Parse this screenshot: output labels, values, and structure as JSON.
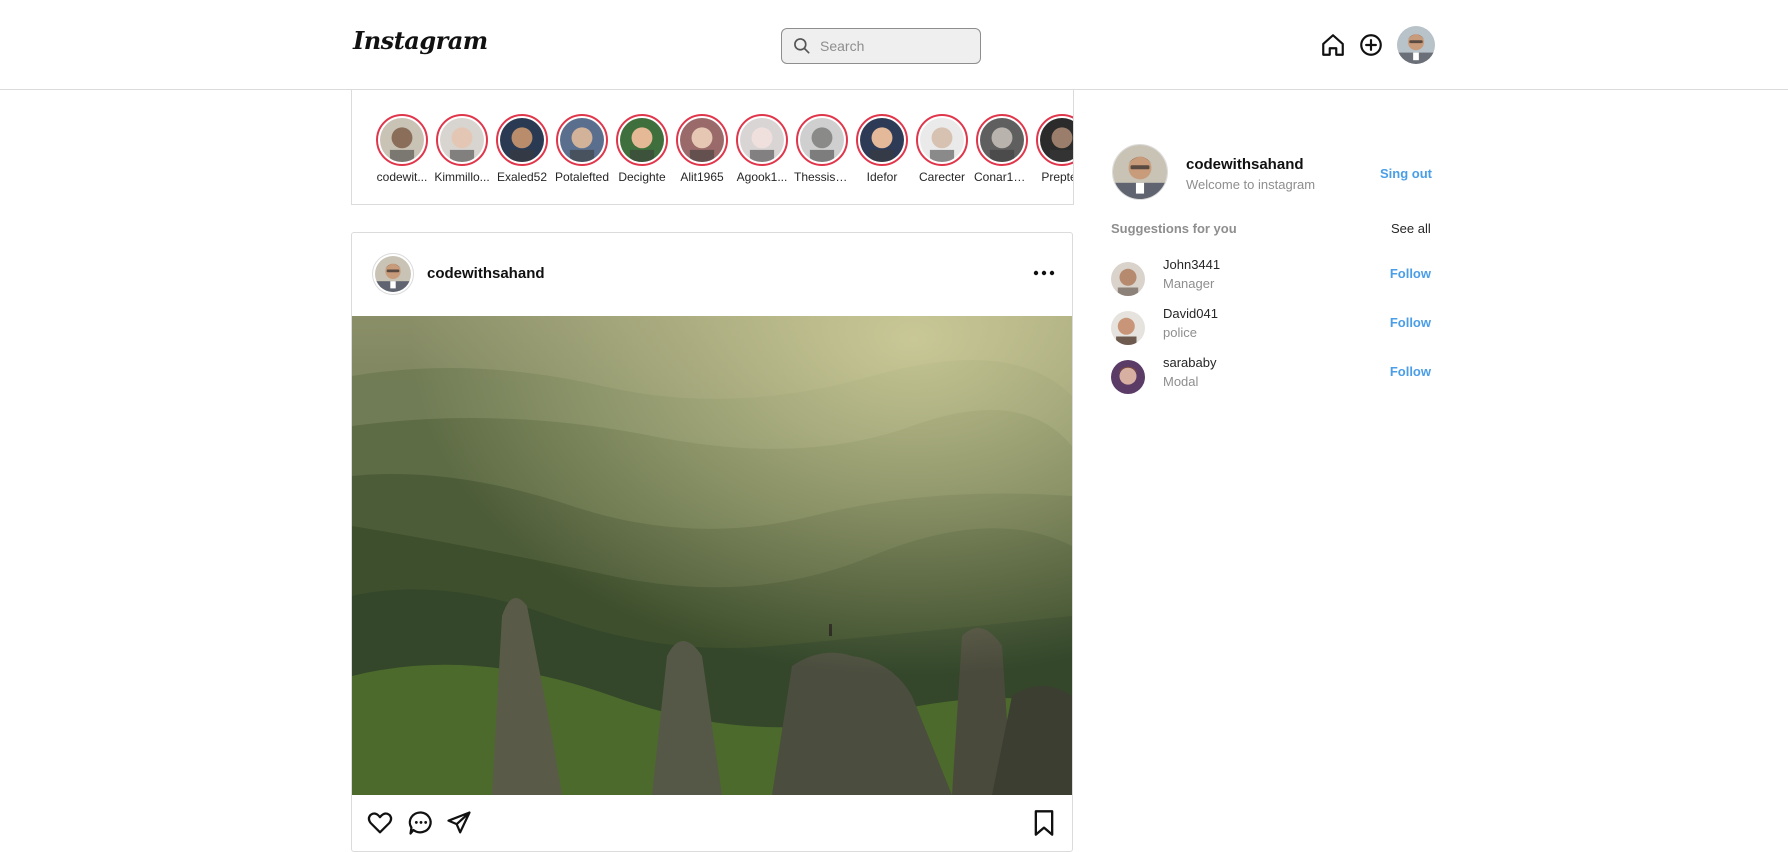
{
  "header": {
    "logo": "Instagram",
    "search_placeholder": "Search",
    "icons": [
      "home-icon",
      "add-post-icon",
      "profile-avatar"
    ]
  },
  "stories": [
    {
      "name": "codewit...",
      "tone": "#8a6e5a",
      "bg": "#c9c3b5"
    },
    {
      "name": "Kimmillo...",
      "tone": "#e3c7b4",
      "bg": "#d8d4d0"
    },
    {
      "name": "Exaled52",
      "tone": "#b98d6c",
      "bg": "#2a3a52"
    },
    {
      "name": "Potalefted",
      "tone": "#d2b39a",
      "bg": "#5a6f8d"
    },
    {
      "name": "Decighte",
      "tone": "#e5b995",
      "bg": "#3f6f3c"
    },
    {
      "name": "Alit1965",
      "tone": "#e6c7b3",
      "bg": "#9a6a6a"
    },
    {
      "name": "Agook1...",
      "tone": "#f0e0dd",
      "bg": "#d9d5d5"
    },
    {
      "name": "Thessisc...",
      "tone": "#8a8a88",
      "bg": "#cfcfcf"
    },
    {
      "name": "Idefor",
      "tone": "#e4b99a",
      "bg": "#2e3b56"
    },
    {
      "name": "Carecter",
      "tone": "#d7c2b2",
      "bg": "#eaeaea"
    },
    {
      "name": "Conar19...",
      "tone": "#b9b3ad",
      "bg": "#5f5f5f"
    },
    {
      "name": "Preptec",
      "tone": "#9a7d6a",
      "bg": "#2b2b2b"
    }
  ],
  "post": {
    "username": "codewithsahand",
    "more_icon": "more-horizontal-icon",
    "action_icons": [
      "heart-icon",
      "comment-icon",
      "share-icon",
      "bookmark-icon"
    ]
  },
  "sidebar": {
    "me": {
      "username": "codewithsahand",
      "subtitle": "Welcome to instagram",
      "signout": "Sing out"
    },
    "suggestions_title": "Suggestions for you",
    "see_all": "See all",
    "suggestions": [
      {
        "username": "John3441",
        "role": "Manager",
        "action": "Follow"
      },
      {
        "username": "David041",
        "role": "police",
        "action": "Follow"
      },
      {
        "username": "sarababy",
        "role": "Modal",
        "action": "Follow"
      }
    ]
  },
  "colors": {
    "story_ring": "#e0364b",
    "link_blue": "#4a9ee8",
    "border": "#dbdbdb"
  }
}
